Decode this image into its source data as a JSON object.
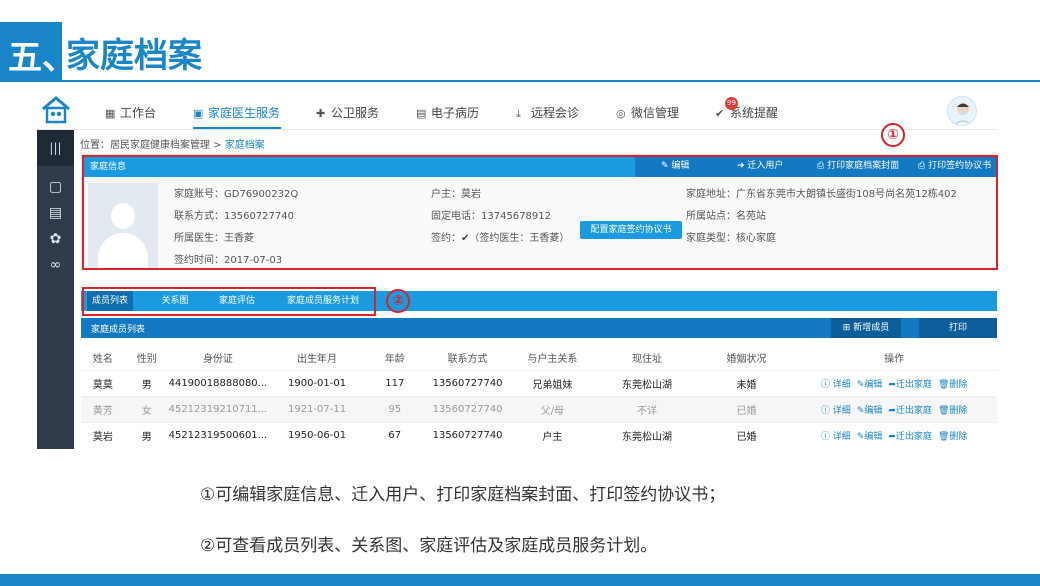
{
  "slide": {
    "number": "五、",
    "title": "家庭档案"
  },
  "nav": {
    "items": [
      {
        "icon": "grid-icon",
        "label": "工作台"
      },
      {
        "icon": "building-icon",
        "label": "家庭医生服务"
      },
      {
        "icon": "plus-circle-icon",
        "label": "公卫服务"
      },
      {
        "icon": "record-icon",
        "label": "电子病历"
      },
      {
        "icon": "download-icon",
        "label": "远程会诊"
      },
      {
        "icon": "wechat-icon",
        "label": "微信管理"
      },
      {
        "icon": "check-badge-icon",
        "label": "系统提醒"
      }
    ],
    "active_index": 1,
    "badge": "99"
  },
  "breadcrumb": {
    "prefix": "位置：",
    "parent": "居民家庭健康档案管理",
    "sep": " > ",
    "current": "家庭档案"
  },
  "family": {
    "header_title": "家庭信息",
    "actions": {
      "edit": "编辑",
      "move_in": "迁入用户",
      "print_cover": "打印家庭档案封面",
      "print_agreement": "打印签约协议书"
    },
    "account": "家庭账号：GD76900232Q",
    "contact": "联系方式：13560727740",
    "doctor": "所属医生：王香菱",
    "sign_time": "签约时间：2017-07-03",
    "head": "户主：莫岩",
    "landline": "固定电话：13745678912",
    "sign_prefix": "签约：",
    "sign_detail": "（签约医生：王香菱）",
    "config_button": "配置家庭签约协议书",
    "address": "家庭地址：广东省东莞市大朗镇长盛街108号尚名苑12栋402",
    "station": "所属站点：名苑站",
    "type": "家庭类型：核心家庭"
  },
  "tabs": [
    "成员列表",
    "关系图",
    "家庭评估",
    "家庭成员服务计划"
  ],
  "members": {
    "title": "家庭成员列表",
    "add_button": "新增成员",
    "print_button": "打印",
    "headers": [
      "姓名",
      "性别",
      "身份证",
      "出生年月",
      "年龄",
      "联系方式",
      "与户主关系",
      "现住址",
      "婚姻状况",
      "操作"
    ],
    "ops": [
      "详细",
      "编辑",
      "迁出家庭",
      "删除"
    ],
    "rows": [
      {
        "name": "莫莫",
        "gender": "男",
        "id": "44190018888080...",
        "birth": "1900-01-01",
        "age": "117",
        "phone": "13560727740",
        "relation": "兄弟姐妹",
        "address": "东莞松山湖",
        "marital": "未婚"
      },
      {
        "name": "黄芳",
        "gender": "女",
        "id": "45212319210711...",
        "birth": "1921-07-11",
        "age": "95",
        "phone": "13560727740",
        "relation": "父/母",
        "address": "不详",
        "marital": "已婚"
      },
      {
        "name": "莫岩",
        "gender": "男",
        "id": "45212319500601...",
        "birth": "1950-06-01",
        "age": "67",
        "phone": "13560727740",
        "relation": "户主",
        "address": "东莞松山湖",
        "marital": "已婚"
      }
    ]
  },
  "annotations": {
    "one": "①",
    "two": "②"
  },
  "descriptions": {
    "line1": "①可编辑家庭信息、迁入用户、打印家庭档案封面、打印签约协议书；",
    "line2": "②可查看成员列表、关系图、家庭评估及家庭成员服务计划。"
  }
}
